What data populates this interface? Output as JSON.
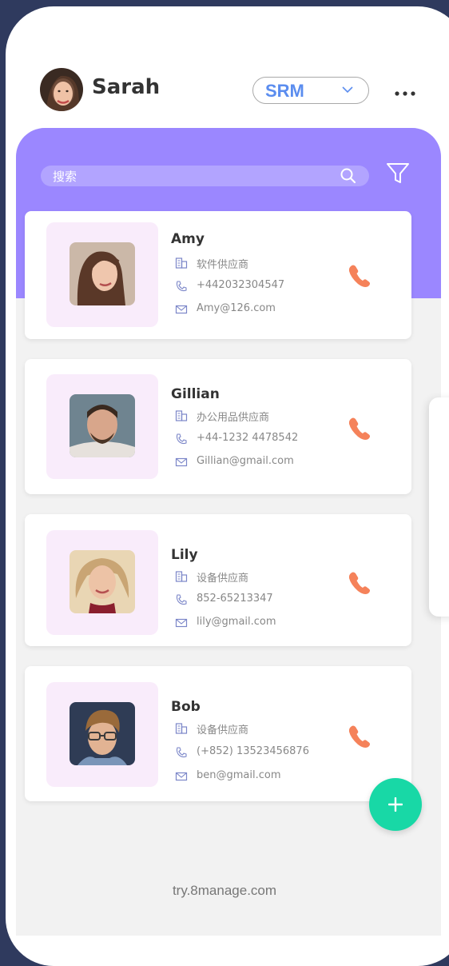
{
  "header": {
    "user_name": "Sarah",
    "app_selector": "SRM"
  },
  "search": {
    "placeholder": "搜索"
  },
  "contacts": [
    {
      "name": "Amy",
      "company": "软件供应商",
      "phone": "+442032304547",
      "email": "Amy@126.com"
    },
    {
      "name": "Gillian",
      "company": "办公用品供应商",
      "phone": "+44-1232 4478542",
      "email": "Gillian@gmail.com"
    },
    {
      "name": "Lily",
      "company": "设备供应商",
      "phone": "852-65213347",
      "email": "lily@gmail.com"
    },
    {
      "name": "Bob",
      "company": "设备供应商",
      "phone": "(+852) 13523456876",
      "email": "ben@gmail.com"
    }
  ],
  "footer": {
    "text": "try.8manage.com"
  },
  "colors": {
    "header_purple": "#9b87ff",
    "accent_blue": "#5b8def",
    "call_orange": "#f5825a",
    "fab_green": "#18d8a6",
    "photo_bg": "#f9ecfb"
  },
  "icons": {
    "more": "more-icon",
    "chevron": "chevron-down-icon",
    "search": "search-icon",
    "filter": "filter-icon",
    "company": "building-icon",
    "phone": "phone-icon",
    "email": "mail-icon",
    "call": "call-icon",
    "add": "plus-icon"
  }
}
